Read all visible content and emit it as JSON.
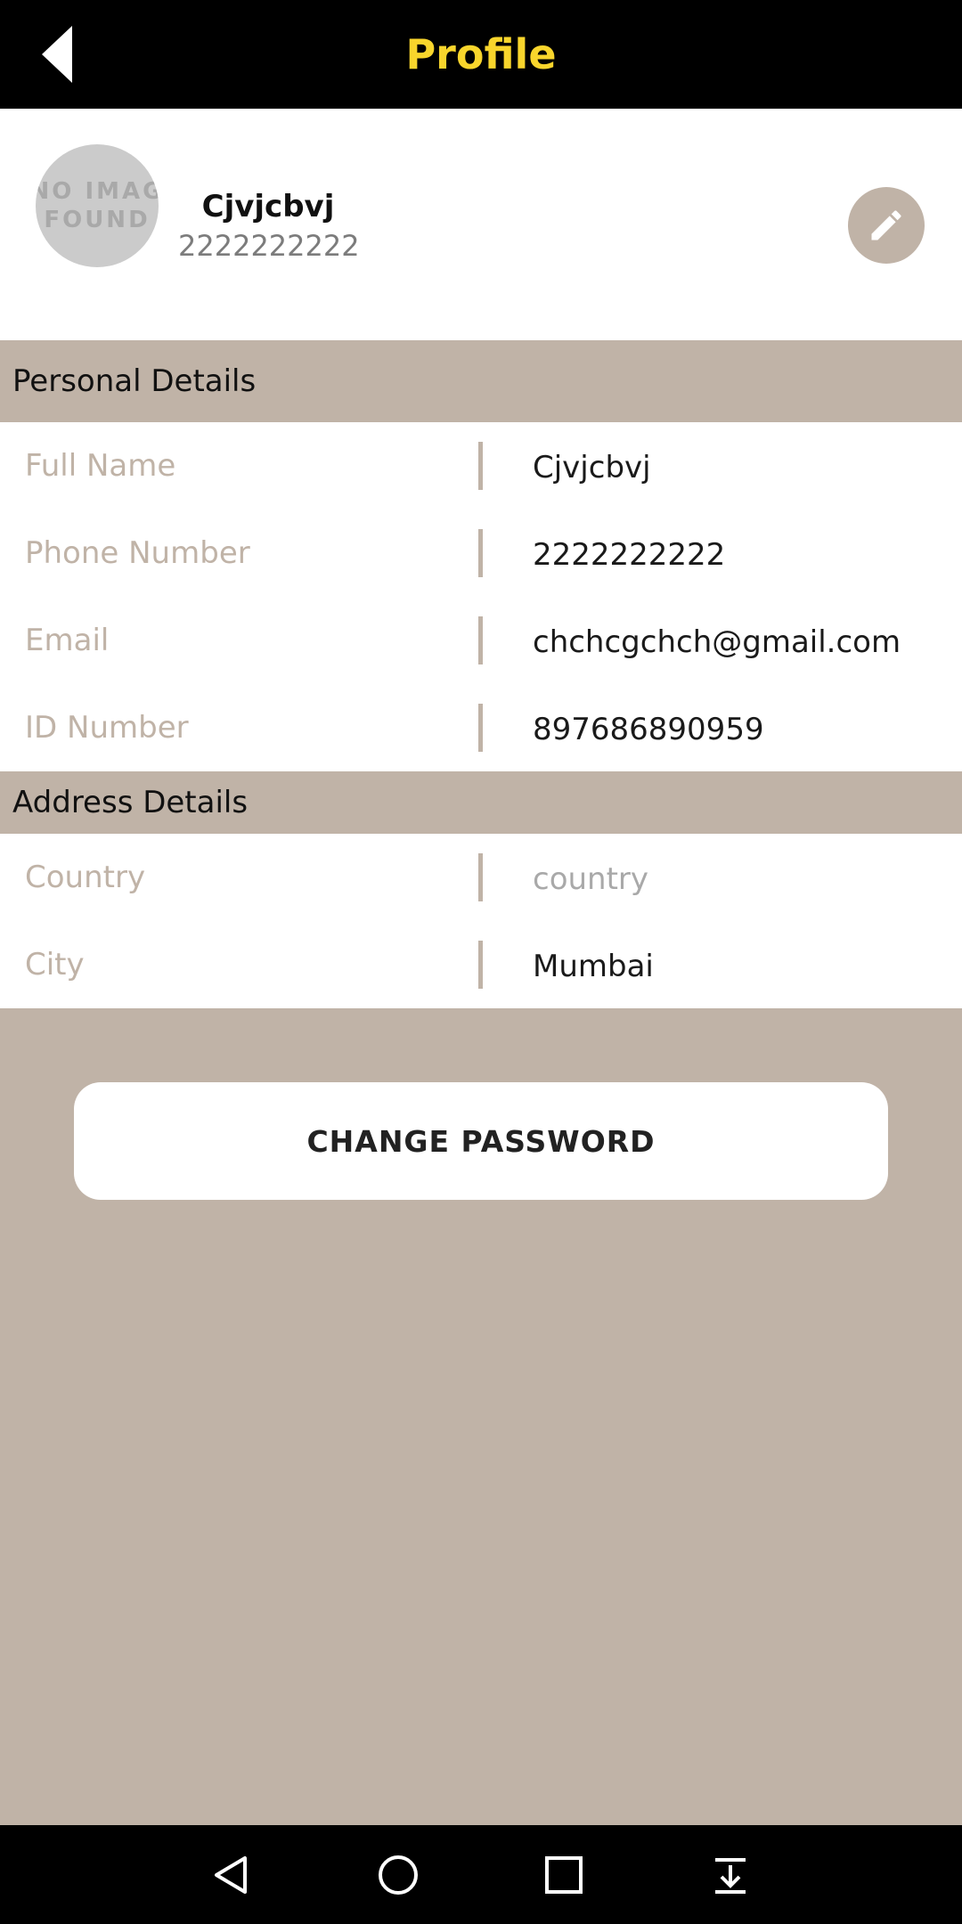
{
  "app_bar": {
    "title": "Profile",
    "back_icon": "back-arrow-icon",
    "color": "#f8d52c"
  },
  "profile": {
    "avatar_text": "NO IMAG\nFOUND",
    "name": "Cjvjcbvj",
    "phone": "2222222222",
    "edit_icon": "pencil-icon"
  },
  "personal_details": {
    "title": "Personal Details",
    "rows": [
      {
        "label": "Full Name",
        "value": "Cjvjcbvj"
      },
      {
        "label": "Phone Number",
        "value": "2222222222"
      },
      {
        "label": "Email",
        "value": "chchcgchch@gmail.com"
      },
      {
        "label": "ID Number",
        "value": "897686890959"
      }
    ]
  },
  "address_details": {
    "title": "Address Details",
    "rows": [
      {
        "label": "Country",
        "placeholder": "country"
      },
      {
        "label": "City",
        "value": "Mumbai"
      }
    ]
  },
  "change_password_label": "CHANGE PASSWORD",
  "colors": {
    "accent": "#c0b3a7",
    "title": "#f8d52c",
    "bar": "#000000"
  },
  "nav_bar": {
    "icons": [
      "nav-back-icon",
      "nav-home-icon",
      "nav-recents-icon",
      "nav-dropdown-icon"
    ]
  }
}
